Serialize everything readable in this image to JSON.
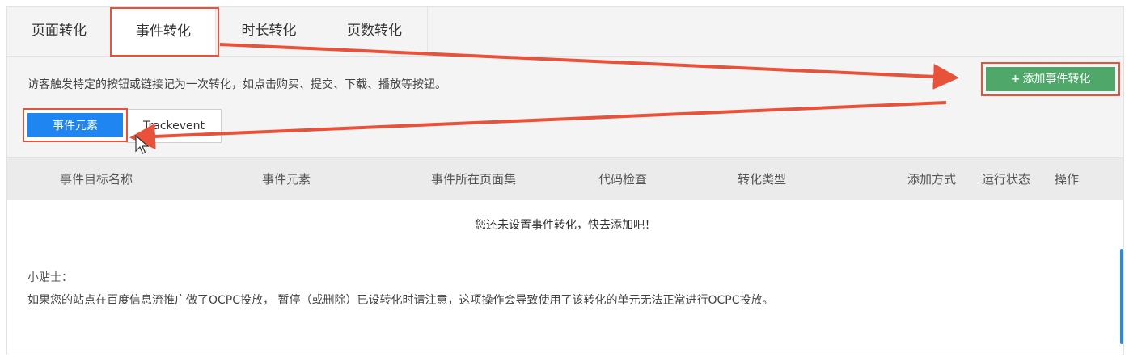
{
  "tabs": [
    "页面转化",
    "事件转化",
    "时长转化",
    "页数转化"
  ],
  "description": "访客触发特定的按钮或链接记为一次转化，如点击购买、提交、下载、播放等按钮。",
  "add_button": {
    "icon": "+",
    "label": "添加事件转化"
  },
  "subtabs": [
    "事件元素",
    "Trackevent"
  ],
  "table": {
    "columns": [
      "事件目标名称",
      "事件元素",
      "事件所在页面集",
      "代码检查",
      "转化类型",
      "添加方式",
      "运行状态",
      "操作"
    ],
    "empty_message": "您还未设置事件转化，快去添加吧！"
  },
  "tips": {
    "title": "小贴士：",
    "text": "如果您的站点在百度信息流推广做了OCPC投放， 暂停（或删除）已设转化时请注意，这项操作会导致使用了该转化的单元无法正常进行OCPC投放。"
  },
  "colors": {
    "accent_blue": "#1f85f0",
    "add_green": "#4fa86a",
    "highlight_red": "#e8513a"
  }
}
